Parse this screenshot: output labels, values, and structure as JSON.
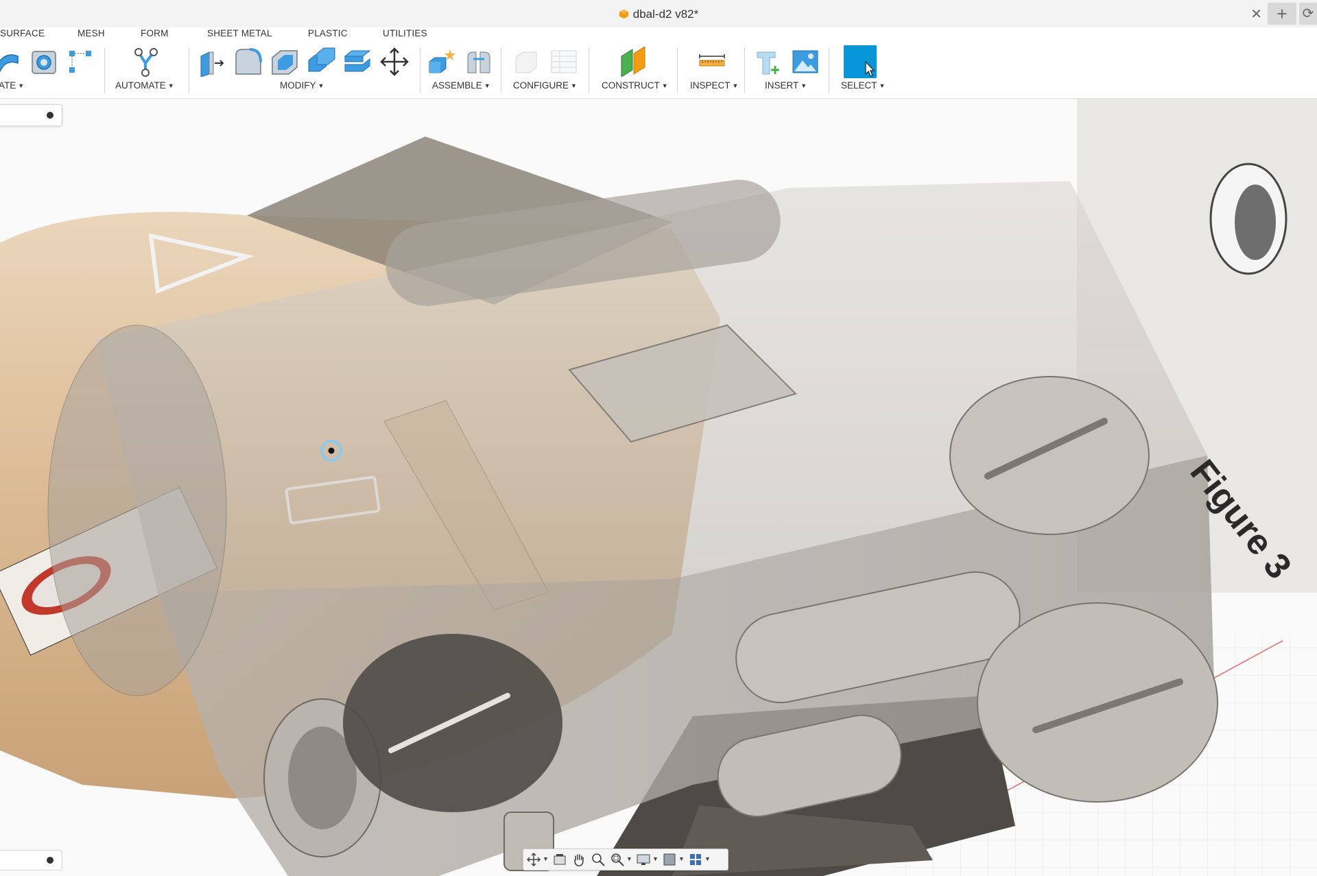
{
  "window": {
    "document_title": "dbal-d2 v82*",
    "close_tab_glyph": "✕",
    "new_tab_glyph": "+",
    "extra_glyph": "⟳"
  },
  "ribbon": {
    "tabs": [
      {
        "id": "surface",
        "label": "SURFACE"
      },
      {
        "id": "mesh",
        "label": "MESH"
      },
      {
        "id": "form",
        "label": "FORM"
      },
      {
        "id": "sheet-metal",
        "label": "SHEET METAL"
      },
      {
        "id": "plastic",
        "label": "PLASTIC"
      },
      {
        "id": "utilities",
        "label": "UTILITIES"
      }
    ],
    "groups": {
      "create": "ATE",
      "automate": "AUTOMATE",
      "modify": "MODIFY",
      "assemble": "ASSEMBLE",
      "configure": "CONFIGURE",
      "construct": "CONSTRUCT",
      "inspect": "INSPECT",
      "insert": "INSERT",
      "select": "SELECT"
    },
    "caret": "▼"
  },
  "viewport": {
    "figure_label": "Figure 3",
    "accent_color": "#0696d7"
  },
  "navbar": {
    "icons": [
      "orbit-icon",
      "look-at-icon",
      "pan-icon",
      "zoom-icon",
      "zoom-window-icon",
      "display-settings-icon",
      "visual-style-icon",
      "viewports-icon"
    ]
  }
}
